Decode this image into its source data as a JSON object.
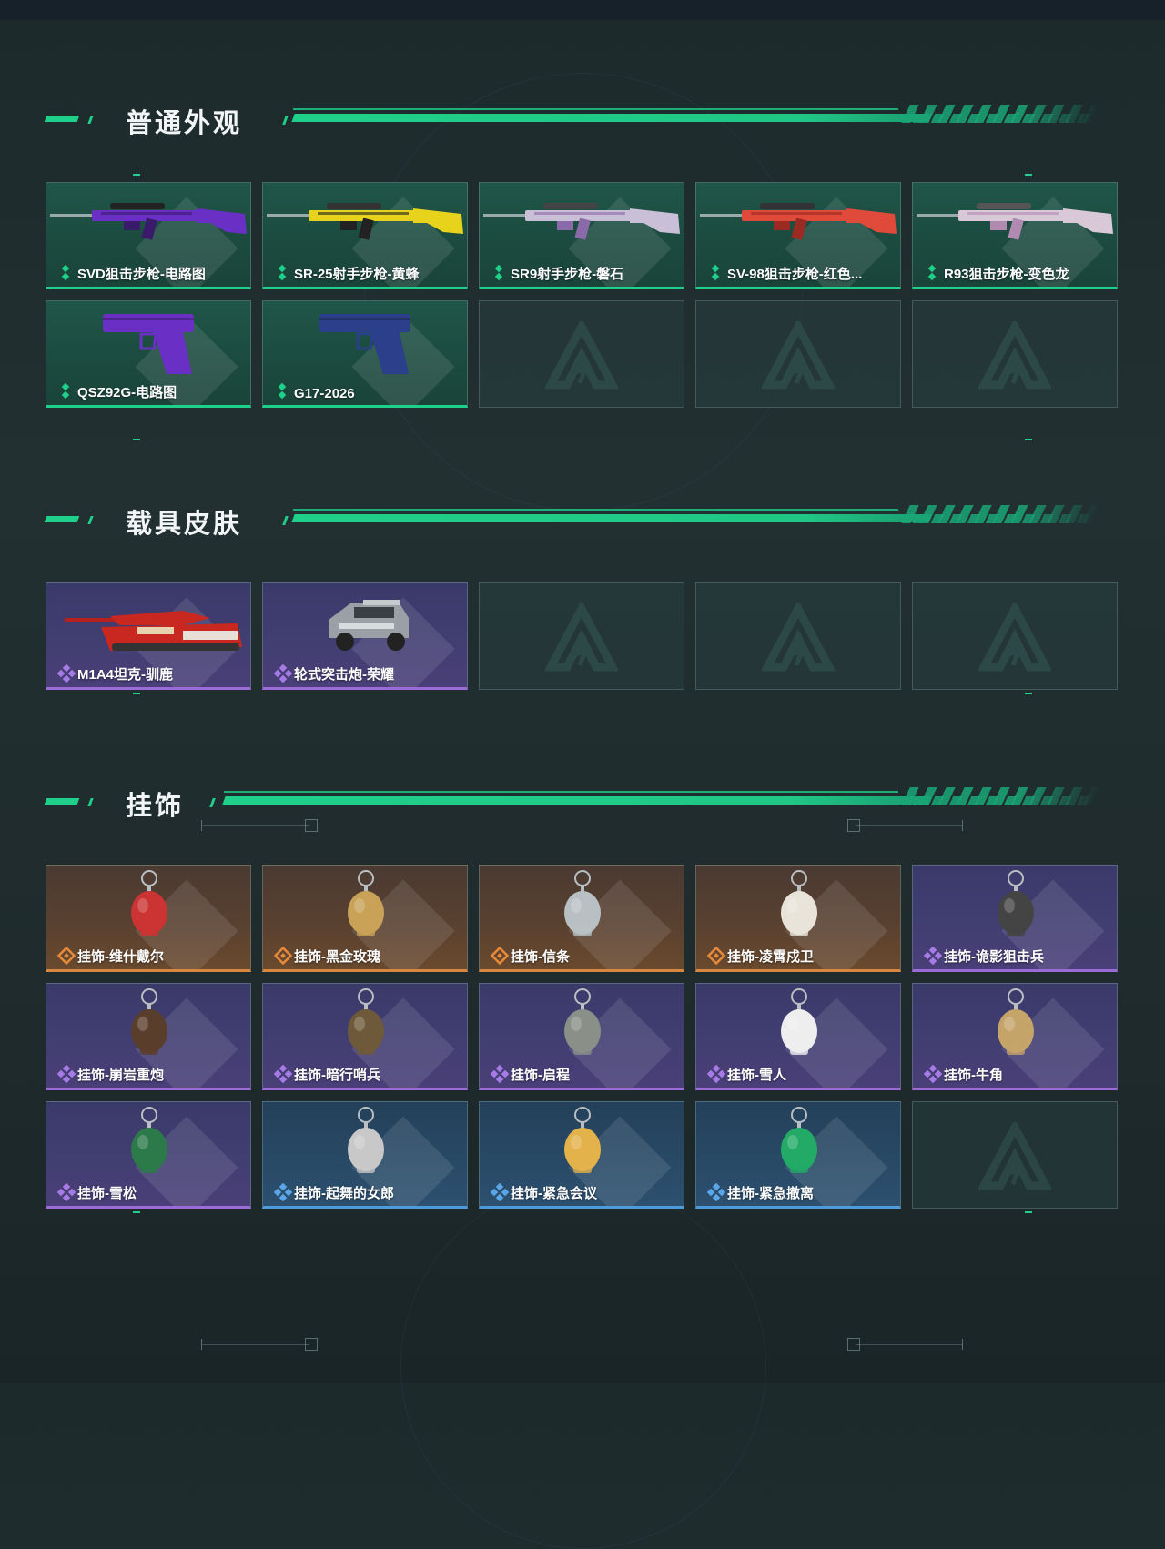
{
  "sections": [
    {
      "title": "普通外观",
      "items": [
        {
          "label": "SVD狙击步枪-电路图",
          "rarity": "green",
          "icon": "sniper-rifle-icon"
        },
        {
          "label": "SR-25射手步枪-黄蜂",
          "rarity": "green",
          "icon": "marksman-rifle-icon"
        },
        {
          "label": "SR9射手步枪-磐石",
          "rarity": "green",
          "icon": "marksman-rifle-icon"
        },
        {
          "label": "SV-98狙击步枪-红色...",
          "rarity": "green",
          "icon": "sniper-rifle-icon"
        },
        {
          "label": "R93狙击步枪-变色龙",
          "rarity": "green",
          "icon": "sniper-rifle-icon"
        },
        {
          "label": "QSZ92G-电路图",
          "rarity": "green",
          "icon": "pistol-icon"
        },
        {
          "label": "G17-2026",
          "rarity": "green",
          "icon": "pistol-icon"
        }
      ]
    },
    {
      "title": "载具皮肤",
      "items": [
        {
          "label": "M1A4坦克-驯鹿",
          "rarity": "purple",
          "icon": "tank-icon"
        },
        {
          "label": "轮式突击炮-荣耀",
          "rarity": "purple",
          "icon": "armored-car-icon"
        }
      ]
    },
    {
      "title": "挂饰",
      "items": [
        {
          "label": "挂饰-维什戴尔",
          "rarity": "orange",
          "icon": "charm-icon"
        },
        {
          "label": "挂饰-黑金玫瑰",
          "rarity": "orange",
          "icon": "charm-icon"
        },
        {
          "label": "挂饰-信条",
          "rarity": "orange",
          "icon": "charm-icon"
        },
        {
          "label": "挂饰-凌霄戍卫",
          "rarity": "orange",
          "icon": "charm-icon"
        },
        {
          "label": "挂饰-诡影狙击兵",
          "rarity": "purple",
          "icon": "charm-icon"
        },
        {
          "label": "挂饰-崩岩重炮",
          "rarity": "purple",
          "icon": "charm-icon"
        },
        {
          "label": "挂饰-暗行哨兵",
          "rarity": "purple",
          "icon": "charm-icon"
        },
        {
          "label": "挂饰-启程",
          "rarity": "purple",
          "icon": "charm-icon"
        },
        {
          "label": "挂饰-雪人",
          "rarity": "purple",
          "icon": "charm-icon"
        },
        {
          "label": "挂饰-牛角",
          "rarity": "purple",
          "icon": "charm-icon"
        },
        {
          "label": "挂饰-雪松",
          "rarity": "purple",
          "icon": "charm-icon"
        },
        {
          "label": "挂饰-起舞的女郎",
          "rarity": "blue",
          "icon": "charm-icon"
        },
        {
          "label": "挂饰-紧急会议",
          "rarity": "blue",
          "icon": "charm-icon"
        },
        {
          "label": "挂饰-紧急撤离",
          "rarity": "blue",
          "icon": "charm-icon"
        }
      ]
    }
  ],
  "colors": {
    "accent": "#1fd08a",
    "green_rarity": "#1fd08a",
    "purple_rarity": "#9b6bd8",
    "orange_rarity": "#d9873e",
    "blue_rarity": "#4f9ad8"
  }
}
